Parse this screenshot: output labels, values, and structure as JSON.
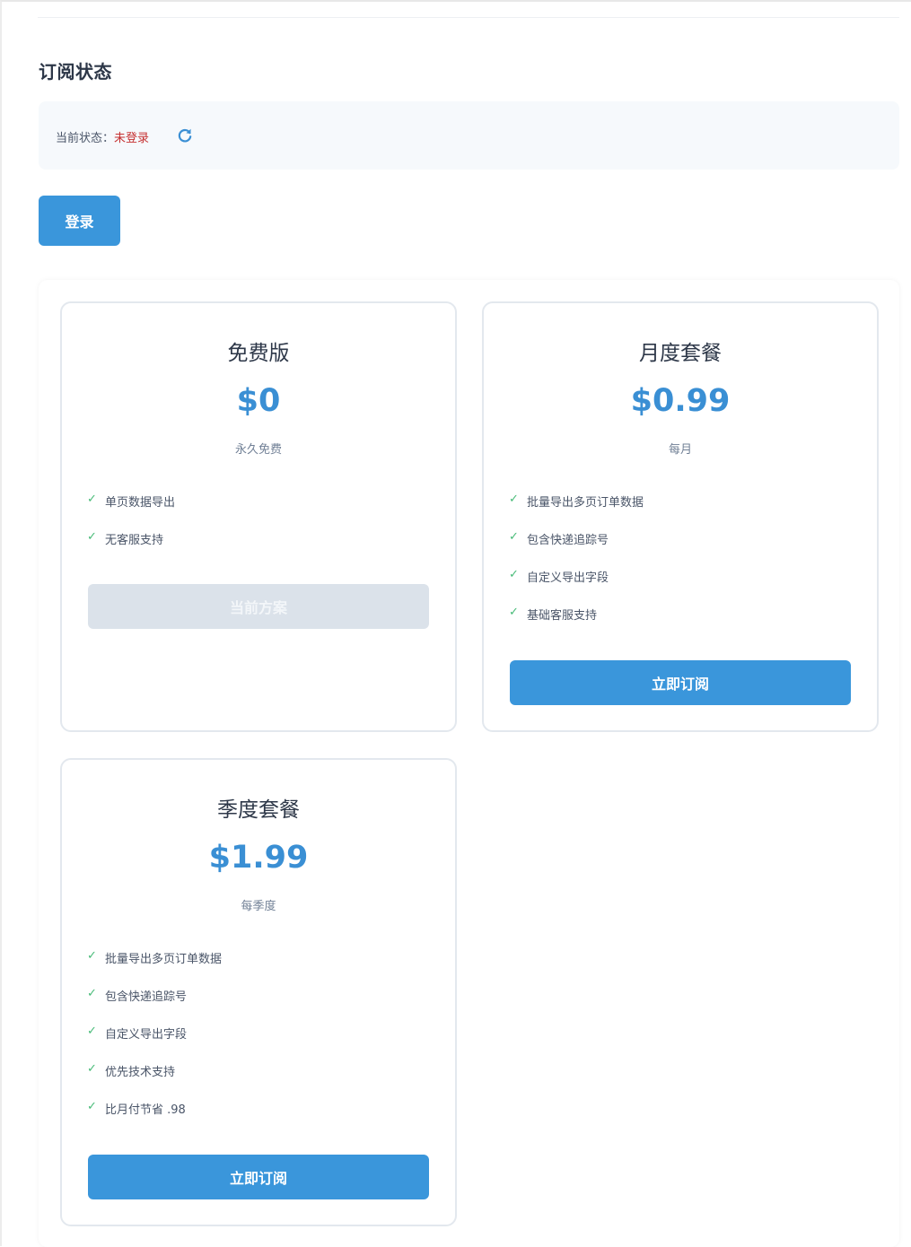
{
  "subscription": {
    "title": "订阅状态",
    "status_label": "当前状态：",
    "status_value": "未登录",
    "status_color": "#c53030",
    "refresh_icon": "refresh-icon",
    "login_label": "登录"
  },
  "colors": {
    "accent": "#3a96db",
    "price": "#3a8fd4",
    "check": "#48bb78",
    "disabled": "#dbe2ea"
  },
  "plans": [
    {
      "name": "免费版",
      "price": "$0",
      "period": "永久免费",
      "features": [
        "单页数据导出",
        "无客服支持"
      ],
      "button_label": "当前方案",
      "button_state": "disabled"
    },
    {
      "name": "月度套餐",
      "price": "$0.99",
      "period": "每月",
      "features": [
        "批量导出多页订单数据",
        "包含快递追踪号",
        "自定义导出字段",
        "基础客服支持"
      ],
      "button_label": "立即订阅",
      "button_state": "primary"
    },
    {
      "name": "季度套餐",
      "price": "$1.99",
      "period": "每季度",
      "features": [
        "批量导出多页订单数据",
        "包含快递追踪号",
        "自定义导出字段",
        "优先技术支持",
        "比月付节省 .98"
      ],
      "button_label": "立即订阅",
      "button_state": "primary"
    }
  ],
  "check_glyph": "✓"
}
